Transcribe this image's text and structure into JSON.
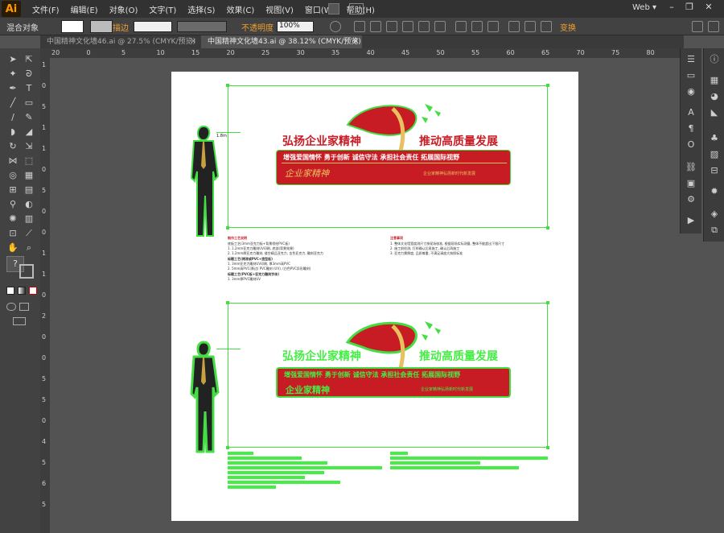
{
  "app": {
    "logo": "Ai",
    "workspace": "Web ▾"
  },
  "menu": [
    "文件(F)",
    "编辑(E)",
    "对象(O)",
    "文字(T)",
    "选择(S)",
    "效果(C)",
    "视图(V)",
    "窗口(W)",
    "帮助(H)"
  ],
  "control": {
    "object_type": "混合对象",
    "stroke_label": "描边",
    "opacity_label": "不透明度",
    "opacity_value": "100%",
    "transform_label": "变换",
    "accent": "#f0a030"
  },
  "tabs": [
    {
      "label": "中国精神文化墙46.ai @ 27.5% (CMYK/预览)",
      "close": "✕"
    },
    {
      "label": "中国精神文化墙43.ai @ 38.12% (CMYK/预览)",
      "close": "✕"
    }
  ],
  "ruler": {
    "h": [
      "20",
      "0",
      "5",
      "10",
      "15",
      "20",
      "25",
      "30",
      "35",
      "40",
      "45",
      "50",
      "55",
      "60",
      "65",
      "70",
      "75",
      "80"
    ],
    "v": [
      "1",
      "0",
      "5",
      "1",
      "1",
      "0",
      "5",
      "0",
      "0",
      "1",
      "1",
      "0",
      "2",
      "0",
      "0",
      "5",
      "5",
      "0",
      "4",
      "5",
      "6",
      "5"
    ]
  },
  "tools_icons": [
    "selection-icon",
    "direct-selection-icon",
    "magic-wand-icon",
    "lasso-icon",
    "pen-icon",
    "type-icon",
    "line-icon",
    "rectangle-icon",
    "paintbrush-icon",
    "pencil-icon",
    "blob-brush-icon",
    "eraser-icon",
    "rotate-icon",
    "scale-icon",
    "width-icon",
    "free-transform-icon",
    "shape-builder-icon",
    "perspective-icon",
    "mesh-icon",
    "gradient-icon",
    "eyedropper-icon",
    "blend-icon",
    "symbol-sprayer-icon",
    "column-graph-icon",
    "artboard-icon",
    "slice-icon",
    "hand-icon",
    "zoom-icon"
  ],
  "artwork": {
    "title_left": "弘扬企业家精神",
    "title_right": "推动高质量发展",
    "banner_text": "增强爱国情怀  勇于创新  诚信守法  承担社会责任  拓展国际视野",
    "script_text": "企业家精神",
    "small_script": "企业家精神弘扬新时代新发展",
    "label_size": "1.8m",
    "note_title_left": "制作工艺说明",
    "note_title_right": "注意事项",
    "notes_left": [
      "底板工艺(3mm亚克力板+背景喷绘PVC板)",
      "1. 1.2mm亚克力雕刻UV印刷, 底部(背景效果)",
      "2. 1.2mm厚亚克力雕刻, 镂空精品亚克力, 金色亚克力, 雕刻亚克力",
      "标题工艺(烤漆或PVC+造型板)",
      "1. 3mm亚克力雕刻UV印刷, 厚3mm高PVC",
      "2. 5mm高PVC(厚边) PVC雕刻 (UV), (白色PVC异形雕刻)",
      "标题工艺(PVC板+亚克力雕刻字体)",
      "1. 3mm厚PVC雕刻UV"
    ],
    "notes_right": [
      "1. 整体文化墙宽度测尺寸按现场核准, 根据现场实际测量, 整体不能超出下限尺寸",
      "2. 施工前检测, 打样确认后再施工, 确认后再施工",
      "3. 亚克力需厚度, 品质尊重, 不满足请放大按照标准"
    ]
  },
  "colors": {
    "red": "#c81c24",
    "gold": "#e8c060",
    "selection": "#44dd44",
    "artboard": "#ffffff",
    "canvas": "#535353"
  }
}
